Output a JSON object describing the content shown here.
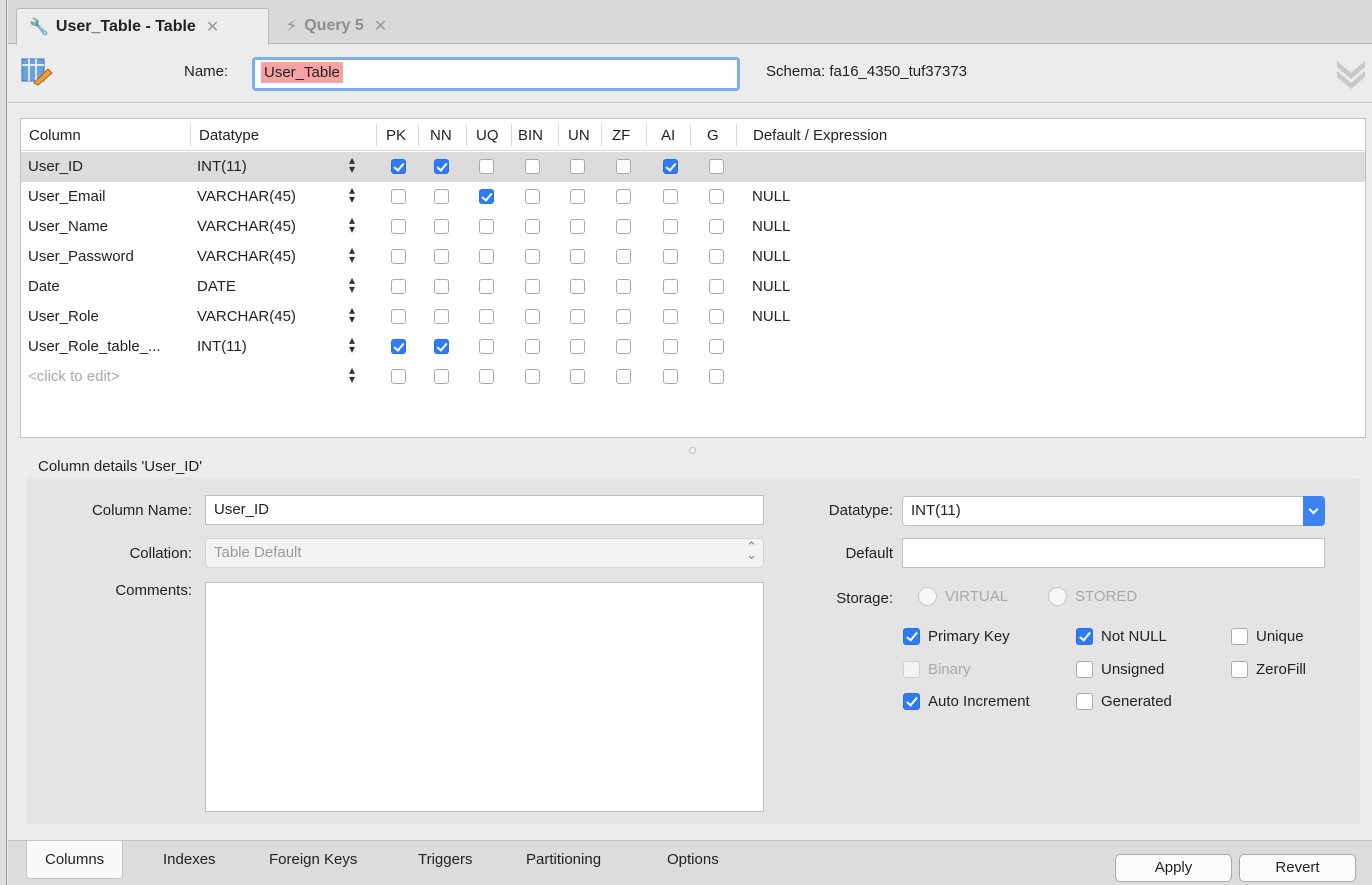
{
  "tabs": [
    {
      "label": "User_Table - Table",
      "icon": "wrench-icon",
      "active": true
    },
    {
      "label": "Query 5",
      "icon": "lightning-icon",
      "active": false
    }
  ],
  "header": {
    "name_label": "Name:",
    "name_value": "User_Table",
    "schema_text": "Schema: fa16_4350_tuf37373"
  },
  "grid": {
    "headers": {
      "column": "Column",
      "datatype": "Datatype",
      "pk": "PK",
      "nn": "NN",
      "uq": "UQ",
      "bin": "BIN",
      "un": "UN",
      "zf": "ZF",
      "ai": "AI",
      "g": "G",
      "default": "Default / Expression"
    },
    "rows": [
      {
        "name": "User_ID",
        "type": "INT(11)",
        "flags": [
          1,
          1,
          0,
          0,
          0,
          0,
          1,
          0
        ],
        "default": ""
      },
      {
        "name": "User_Email",
        "type": "VARCHAR(45)",
        "flags": [
          0,
          0,
          1,
          0,
          0,
          0,
          0,
          0
        ],
        "default": "NULL"
      },
      {
        "name": "User_Name",
        "type": "VARCHAR(45)",
        "flags": [
          0,
          0,
          0,
          0,
          0,
          0,
          0,
          0
        ],
        "default": "NULL"
      },
      {
        "name": "User_Password",
        "type": "VARCHAR(45)",
        "flags": [
          0,
          0,
          0,
          0,
          0,
          0,
          0,
          0
        ],
        "default": "NULL"
      },
      {
        "name": "Date",
        "type": "DATE",
        "flags": [
          0,
          0,
          0,
          0,
          0,
          0,
          0,
          0
        ],
        "default": "NULL"
      },
      {
        "name": "User_Role",
        "type": "VARCHAR(45)",
        "flags": [
          0,
          0,
          0,
          0,
          0,
          0,
          0,
          0
        ],
        "default": "NULL"
      },
      {
        "name": "User_Role_table_...",
        "type": "INT(11)",
        "flags": [
          1,
          1,
          0,
          0,
          0,
          0,
          0,
          0
        ],
        "default": ""
      },
      {
        "name": "<click to edit>",
        "type": "",
        "flags": [
          0,
          0,
          0,
          0,
          0,
          0,
          0,
          0
        ],
        "default": "",
        "placeholder": true
      }
    ]
  },
  "details": {
    "title": "Column details 'User_ID'",
    "column_name_label": "Column Name:",
    "column_name_value": "User_ID",
    "collation_label": "Collation:",
    "collation_value": "Table Default",
    "comments_label": "Comments:",
    "datatype_label": "Datatype:",
    "datatype_value": "INT(11)",
    "default_label": "Default",
    "default_value": "",
    "storage_label": "Storage:",
    "storage_virtual": "VIRTUAL",
    "storage_stored": "STORED",
    "primary_key": "Primary Key",
    "not_null": "Not NULL",
    "unique": "Unique",
    "binary": "Binary",
    "unsigned": "Unsigned",
    "zerofill": "ZeroFill",
    "auto_increment": "Auto Increment",
    "generated": "Generated"
  },
  "bottom_tabs": [
    "Columns",
    "Indexes",
    "Foreign Keys",
    "Triggers",
    "Partitioning",
    "Options"
  ],
  "buttons": {
    "apply": "Apply",
    "revert": "Revert"
  },
  "colors": {
    "accent": "#2f7bf5",
    "name_highlight": "#f7a3a3"
  }
}
